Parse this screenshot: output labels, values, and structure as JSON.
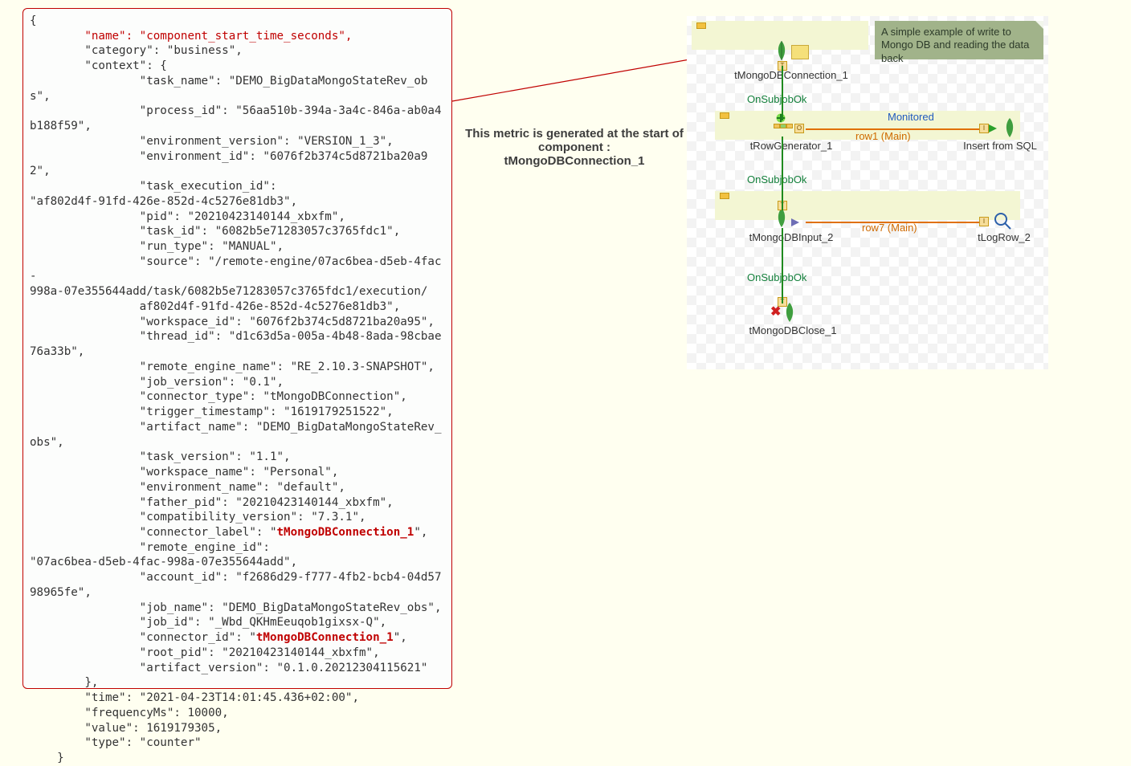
{
  "json_block": {
    "open_brace": "{",
    "name_key": "        \"name\": \"",
    "name_val": "component_start_time_seconds",
    "name_end": "\",",
    "category": "        \"category\": \"business\",",
    "context_open": "        \"context\": {",
    "ctx_task_name": "                \"task_name\": \"DEMO_BigDataMongoStateRev_obs\",",
    "ctx_process_id": "                \"process_id\": \"56aa510b-394a-3a4c-846a-ab0a4b188f59\",",
    "ctx_env_version": "                \"environment_version\": \"VERSION_1_3\",",
    "ctx_env_id": "                \"environment_id\": \"6076f2b374c5d8721ba20a92\",",
    "ctx_task_exec_key": "                \"task_execution_id\":",
    "ctx_task_exec_val": "\"af802d4f-91fd-426e-852d-4c5276e81db3\",",
    "ctx_pid": "                \"pid\": \"20210423140144_xbxfm\",",
    "ctx_task_id": "                \"task_id\": \"6082b5e71283057c3765fdc1\",",
    "ctx_run_type": "                \"run_type\": \"MANUAL\",",
    "ctx_source_key": "                \"source\": \"/remote-engine/07ac6bea-d5eb-4fac-",
    "ctx_source_mid": "998a-07e355644add/task/6082b5e71283057c3765fdc1/execution/",
    "ctx_source_end": "                af802d4f-91fd-426e-852d-4c5276e81db3\",",
    "ctx_workspace_id": "                \"workspace_id\": \"6076f2b374c5d8721ba20a95\",",
    "ctx_thread_id": "                \"thread_id\": \"d1c63d5a-005a-4b48-8ada-98cbae76a33b\",",
    "ctx_remote_engine_name": "                \"remote_engine_name\": \"RE_2.10.3-SNAPSHOT\",",
    "ctx_job_version": "                \"job_version\": \"0.1\",",
    "ctx_connector_type": "                \"connector_type\": \"tMongoDBConnection\",",
    "ctx_trigger_ts": "                \"trigger_timestamp\": \"1619179251522\",",
    "ctx_artifact_name": "                \"artifact_name\": \"DEMO_BigDataMongoStateRev_obs\",",
    "ctx_task_version": "                \"task_version\": \"1.1\",",
    "ctx_workspace_name": "                \"workspace_name\": \"Personal\",",
    "ctx_env_name": "                \"environment_name\": \"default\",",
    "ctx_father_pid": "                \"father_pid\": \"20210423140144_xbxfm\",",
    "ctx_compat_version": "                \"compatibility_version\": \"7.3.1\",",
    "ctx_conn_label_key": "                \"connector_label\": \"",
    "ctx_conn_label_val": "tMongoDBConnection_1",
    "ctx_conn_label_end": "\",",
    "ctx_remote_engine_id_key": "                \"remote_engine_id\":",
    "ctx_remote_engine_id_val": "\"07ac6bea-d5eb-4fac-998a-07e355644add\",",
    "ctx_account_id": "                \"account_id\": \"f2686d29-f777-4fb2-bcb4-04d5798965fe\",",
    "ctx_job_name": "                \"job_name\": \"DEMO_BigDataMongoStateRev_obs\",",
    "ctx_job_id": "                \"job_id\": \"_Wbd_QKHmEeuqob1gixsx-Q\",",
    "ctx_conn_id_key": "                \"connector_id\": \"",
    "ctx_conn_id_val": "tMongoDBConnection_1",
    "ctx_conn_id_end": "\",",
    "ctx_root_pid": "                \"root_pid\": \"20210423140144_xbxfm\",",
    "ctx_artifact_version": "                \"artifact_version\": \"0.1.0.20212304115621\"",
    "context_close": "        },",
    "time": "        \"time\": \"2021-04-23T14:01:45.436+02:00\",",
    "frequency": "        \"frequencyMs\": 10000,",
    "value": "        \"value\": 1619179305,",
    "type": "        \"type\": \"counter\"",
    "close_brace": "    }"
  },
  "caption": {
    "line1": "This metric is generated at the start of component :",
    "line2": "tMongoDBConnection_1"
  },
  "diagram": {
    "note": "A simple example of write to Mongo DB and reading the data back",
    "comp_mongo_conn": "tMongoDBConnection_1",
    "subjob1": "OnSubjobOk",
    "comp_rowgen": "tRowGenerator_1",
    "monitored": "Monitored",
    "row1": "row1 (Main)",
    "comp_insert": "Insert from SQL",
    "subjob2": "OnSubjobOk",
    "comp_mongo_input": "tMongoDBInput_2",
    "row7": "row7 (Main)",
    "comp_logrow": "tLogRow_2",
    "subjob3": "OnSubjobOk",
    "comp_mongo_close": "tMongoDBClose_1"
  }
}
